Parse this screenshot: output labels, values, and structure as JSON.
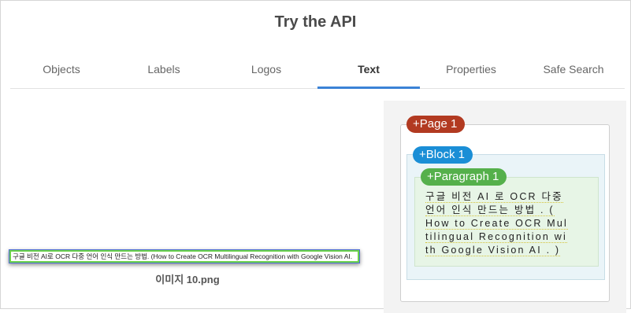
{
  "header": {
    "title": "Try the API"
  },
  "tabs": [
    {
      "label": "Objects",
      "active": false
    },
    {
      "label": "Labels",
      "active": false
    },
    {
      "label": "Logos",
      "active": false
    },
    {
      "label": "Text",
      "active": true
    },
    {
      "label": "Properties",
      "active": false
    },
    {
      "label": "Safe Search",
      "active": false
    }
  ],
  "image": {
    "thumbnail_text": "구글 비전 AI로 OCR 다중 언어 인식 만드는 방법. (How to Create OCR Multilingual Recognition with Google Vision AI.",
    "filename": "이미지 10.png"
  },
  "result": {
    "page_label": "+Page 1",
    "block_label": "+Block 1",
    "paragraph_label": "+Paragraph 1",
    "lines": [
      "구글 비전 AI 로 OCR 다중",
      "언어 인식 만드는 방법 . (",
      "How to Create OCR Mul",
      "tilingual Recognition wi",
      "th Google Vision AI . )"
    ]
  },
  "colors": {
    "page_badge": "#b23a21",
    "block_badge": "#1a8ed6",
    "paragraph_badge": "#55b04b",
    "active_tab": "#3b82d6"
  }
}
